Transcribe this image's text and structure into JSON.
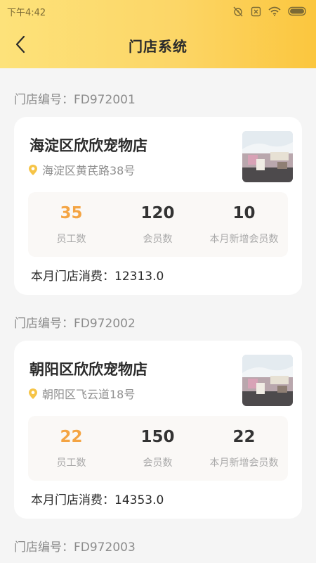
{
  "status_bar": {
    "time": "下午4:42"
  },
  "nav": {
    "title": "门店系统"
  },
  "stores": [
    {
      "id_label": "门店编号：FD972001",
      "name": "海淀区欣欣宠物店",
      "address": "海淀区黄芪路38号",
      "stats": [
        {
          "value": "35",
          "label": "员工数"
        },
        {
          "value": "120",
          "label": "会员数"
        },
        {
          "value": "10",
          "label": "本月新增会员数"
        }
      ],
      "spend": "本月门店消费：12313.0"
    },
    {
      "id_label": "门店编号：FD972002",
      "name": "朝阳区欣欣宠物店",
      "address": "朝阳区飞云道18号",
      "stats": [
        {
          "value": "22",
          "label": "员工数"
        },
        {
          "value": "150",
          "label": "会员数"
        },
        {
          "value": "22",
          "label": "本月新增会员数"
        }
      ],
      "spend": "本月门店消费：14353.0"
    },
    {
      "id_label": "门店编号：FD972003"
    }
  ],
  "colors": {
    "header_start": "#fde27a",
    "header_end": "#fbc63e",
    "accent_orange": "#f4a443",
    "location_pin": "#f6c447"
  }
}
